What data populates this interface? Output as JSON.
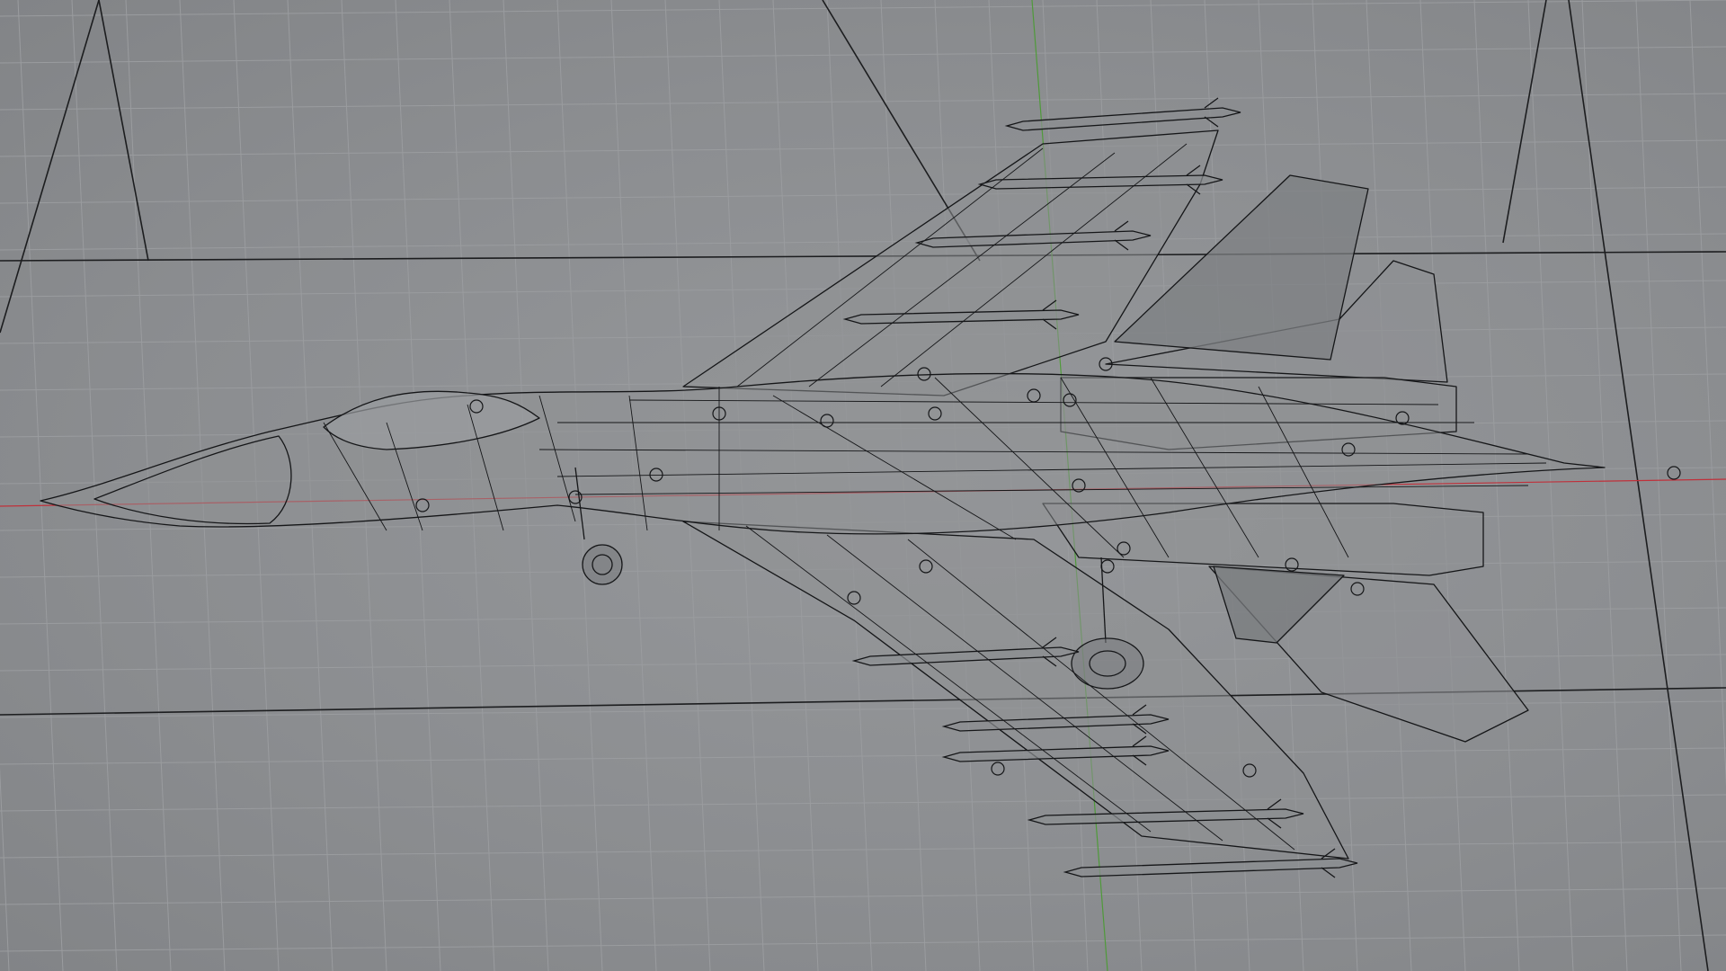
{
  "viewport": {
    "view": "top",
    "shading": "wireframe-ghosted",
    "grid": true,
    "colors": {
      "background": "#8c8e91",
      "grid_minor": "#9a9c9f",
      "grid_major": "#1e1f21",
      "wire": "#151618",
      "panel_fill": "#8a8c8f",
      "x_axis": "#c0303a",
      "y_axis": "#4f9a3a",
      "control_point": "#1a1a1a"
    }
  },
  "model": {
    "kind": "aircraft",
    "description_icon": "jet-fighter-icon",
    "components": [
      "fuselage",
      "canopy",
      "nose-cone",
      "upper-wing",
      "lower-wing",
      "upper-tailplane",
      "lower-tailplane",
      "vertical-fin",
      "engine-nacelles",
      "nose-landing-gear",
      "main-landing-gear",
      "missiles"
    ]
  }
}
